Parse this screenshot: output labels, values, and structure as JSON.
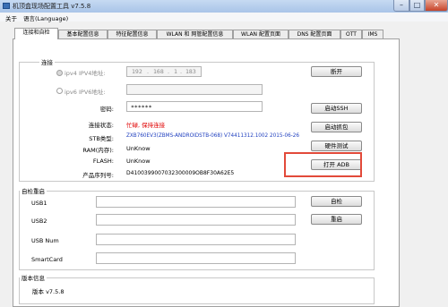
{
  "window": {
    "title": "机顶盒现场配置工具 v7.5.8",
    "controls": {
      "minimize": "–",
      "maximize": "□",
      "close": "✕"
    }
  },
  "menu": {
    "items": [
      "关于",
      "语言(Language)"
    ]
  },
  "tabs": [
    "连接和自检",
    "基本配置信息",
    "特征配置信息",
    "WLAN 和 网管配置信息",
    "WLAN 配置页面",
    "DNS 配置页面",
    "OTT",
    "IMS"
  ],
  "connection": {
    "group_title": "连接",
    "ipv4_label": "ipv4 IPV4地址:",
    "ipv4": [
      "192",
      "168",
      "1",
      "183"
    ],
    "ipv6_label": "ipv6 IPV6地址:",
    "password_label": "密码:",
    "password_value": "******",
    "status_label": "连接状态:",
    "status_value": "忙碌, 保持连接",
    "stb_type_label": "STB类型:",
    "stb_type_value": "ZXB760EV3(ZBMS-ANDROIDSTB-068) V74411312.1002 2015-06-26",
    "ram_label": "RAM(内存):",
    "ram_value": "UnKnow",
    "flash_label": "FLASH:",
    "flash_value": "UnKnow",
    "serial_label": "产品序列号:",
    "serial_value": "D4100399007032300009OB8F30A62E5",
    "buttons": {
      "disconnect": "断开",
      "start_ssh": "启动SSH",
      "start_capture": "启动抓包",
      "hw_test": "硬件测试",
      "open_adb": "打开 ADB"
    }
  },
  "selftest": {
    "group_title": "自检重启",
    "rows": [
      "USB1",
      "USB2",
      "USB Num",
      "SmartCard"
    ],
    "buttons": {
      "selftest": "自检",
      "reboot": "重启"
    }
  },
  "version": {
    "group_title": "版本信息",
    "label": "版本 v7.5.8"
  },
  "colors": {
    "accent_red": "#e24a3a",
    "status_red": "#e00000",
    "stb_blue": "#1f3fbf"
  }
}
